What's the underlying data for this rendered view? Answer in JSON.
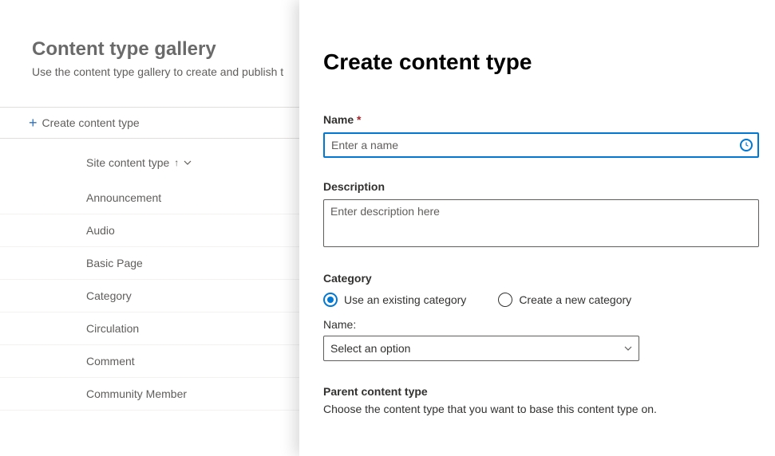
{
  "gallery": {
    "title": "Content type gallery",
    "subtitle": "Use the content type gallery to create and publish t",
    "create_btn": "Create content type",
    "column_header": "Site content type",
    "rows": [
      "Announcement",
      "Audio",
      "Basic Page",
      "Category",
      "Circulation",
      "Comment",
      "Community Member"
    ]
  },
  "panel": {
    "title": "Create content type",
    "name_label": "Name",
    "name_placeholder": "Enter a name",
    "desc_label": "Description",
    "desc_placeholder": "Enter description here",
    "category_label": "Category",
    "radio_existing": "Use an existing category",
    "radio_new": "Create a new category",
    "category_name_label": "Name:",
    "select_placeholder": "Select an option",
    "parent_heading": "Parent content type",
    "parent_desc": "Choose the content type that you want to base this content type on."
  }
}
